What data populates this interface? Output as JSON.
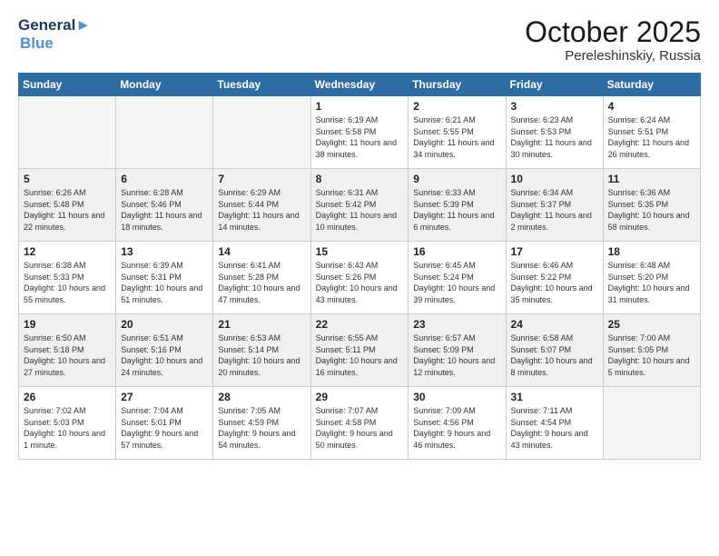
{
  "header": {
    "logo_line1": "General",
    "logo_line2": "Blue",
    "month": "October 2025",
    "location": "Pereleshinskiy, Russia"
  },
  "weekdays": [
    "Sunday",
    "Monday",
    "Tuesday",
    "Wednesday",
    "Thursday",
    "Friday",
    "Saturday"
  ],
  "weeks": [
    {
      "shade": "white",
      "days": [
        {
          "num": "",
          "info": ""
        },
        {
          "num": "",
          "info": ""
        },
        {
          "num": "",
          "info": ""
        },
        {
          "num": "1",
          "info": "Sunrise: 6:19 AM\nSunset: 5:58 PM\nDaylight: 11 hours\nand 38 minutes."
        },
        {
          "num": "2",
          "info": "Sunrise: 6:21 AM\nSunset: 5:55 PM\nDaylight: 11 hours\nand 34 minutes."
        },
        {
          "num": "3",
          "info": "Sunrise: 6:23 AM\nSunset: 5:53 PM\nDaylight: 11 hours\nand 30 minutes."
        },
        {
          "num": "4",
          "info": "Sunrise: 6:24 AM\nSunset: 5:51 PM\nDaylight: 11 hours\nand 26 minutes."
        }
      ]
    },
    {
      "shade": "shaded",
      "days": [
        {
          "num": "5",
          "info": "Sunrise: 6:26 AM\nSunset: 5:48 PM\nDaylight: 11 hours\nand 22 minutes."
        },
        {
          "num": "6",
          "info": "Sunrise: 6:28 AM\nSunset: 5:46 PM\nDaylight: 11 hours\nand 18 minutes."
        },
        {
          "num": "7",
          "info": "Sunrise: 6:29 AM\nSunset: 5:44 PM\nDaylight: 11 hours\nand 14 minutes."
        },
        {
          "num": "8",
          "info": "Sunrise: 6:31 AM\nSunset: 5:42 PM\nDaylight: 11 hours\nand 10 minutes."
        },
        {
          "num": "9",
          "info": "Sunrise: 6:33 AM\nSunset: 5:39 PM\nDaylight: 11 hours\nand 6 minutes."
        },
        {
          "num": "10",
          "info": "Sunrise: 6:34 AM\nSunset: 5:37 PM\nDaylight: 11 hours\nand 2 minutes."
        },
        {
          "num": "11",
          "info": "Sunrise: 6:36 AM\nSunset: 5:35 PM\nDaylight: 10 hours\nand 58 minutes."
        }
      ]
    },
    {
      "shade": "white",
      "days": [
        {
          "num": "12",
          "info": "Sunrise: 6:38 AM\nSunset: 5:33 PM\nDaylight: 10 hours\nand 55 minutes."
        },
        {
          "num": "13",
          "info": "Sunrise: 6:39 AM\nSunset: 5:31 PM\nDaylight: 10 hours\nand 51 minutes."
        },
        {
          "num": "14",
          "info": "Sunrise: 6:41 AM\nSunset: 5:28 PM\nDaylight: 10 hours\nand 47 minutes."
        },
        {
          "num": "15",
          "info": "Sunrise: 6:43 AM\nSunset: 5:26 PM\nDaylight: 10 hours\nand 43 minutes."
        },
        {
          "num": "16",
          "info": "Sunrise: 6:45 AM\nSunset: 5:24 PM\nDaylight: 10 hours\nand 39 minutes."
        },
        {
          "num": "17",
          "info": "Sunrise: 6:46 AM\nSunset: 5:22 PM\nDaylight: 10 hours\nand 35 minutes."
        },
        {
          "num": "18",
          "info": "Sunrise: 6:48 AM\nSunset: 5:20 PM\nDaylight: 10 hours\nand 31 minutes."
        }
      ]
    },
    {
      "shade": "shaded",
      "days": [
        {
          "num": "19",
          "info": "Sunrise: 6:50 AM\nSunset: 5:18 PM\nDaylight: 10 hours\nand 27 minutes."
        },
        {
          "num": "20",
          "info": "Sunrise: 6:51 AM\nSunset: 5:16 PM\nDaylight: 10 hours\nand 24 minutes."
        },
        {
          "num": "21",
          "info": "Sunrise: 6:53 AM\nSunset: 5:14 PM\nDaylight: 10 hours\nand 20 minutes."
        },
        {
          "num": "22",
          "info": "Sunrise: 6:55 AM\nSunset: 5:11 PM\nDaylight: 10 hours\nand 16 minutes."
        },
        {
          "num": "23",
          "info": "Sunrise: 6:57 AM\nSunset: 5:09 PM\nDaylight: 10 hours\nand 12 minutes."
        },
        {
          "num": "24",
          "info": "Sunrise: 6:58 AM\nSunset: 5:07 PM\nDaylight: 10 hours\nand 8 minutes."
        },
        {
          "num": "25",
          "info": "Sunrise: 7:00 AM\nSunset: 5:05 PM\nDaylight: 10 hours\nand 5 minutes."
        }
      ]
    },
    {
      "shade": "white",
      "days": [
        {
          "num": "26",
          "info": "Sunrise: 7:02 AM\nSunset: 5:03 PM\nDaylight: 10 hours\nand 1 minute."
        },
        {
          "num": "27",
          "info": "Sunrise: 7:04 AM\nSunset: 5:01 PM\nDaylight: 9 hours\nand 57 minutes."
        },
        {
          "num": "28",
          "info": "Sunrise: 7:05 AM\nSunset: 4:59 PM\nDaylight: 9 hours\nand 54 minutes."
        },
        {
          "num": "29",
          "info": "Sunrise: 7:07 AM\nSunset: 4:58 PM\nDaylight: 9 hours\nand 50 minutes."
        },
        {
          "num": "30",
          "info": "Sunrise: 7:09 AM\nSunset: 4:56 PM\nDaylight: 9 hours\nand 46 minutes."
        },
        {
          "num": "31",
          "info": "Sunrise: 7:11 AM\nSunset: 4:54 PM\nDaylight: 9 hours\nand 43 minutes."
        },
        {
          "num": "",
          "info": ""
        }
      ]
    }
  ]
}
